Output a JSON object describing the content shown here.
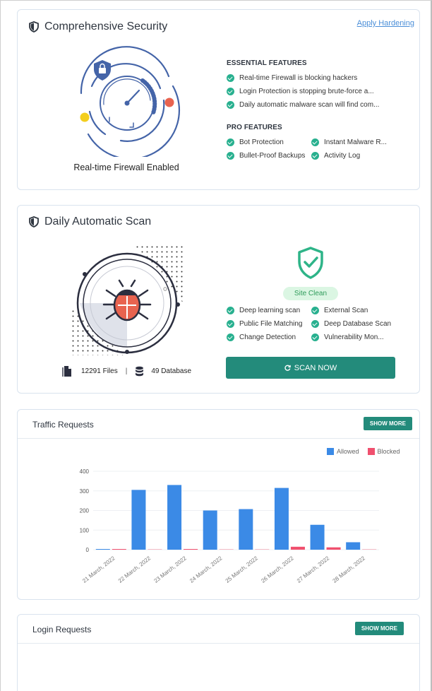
{
  "security": {
    "title": "Comprehensive Security",
    "apply_link": "Apply Hardening",
    "caption": "Real-time Firewall Enabled",
    "essential_heading": "ESSENTIAL FEATURES",
    "essential": [
      "Real-time Firewall is blocking hackers",
      "Login Protection is stopping brute-force a...",
      "Daily automatic malware scan will find com..."
    ],
    "pro_heading": "PRO FEATURES",
    "pro": [
      "Bot Protection",
      "Instant Malware R...",
      "Bullet-Proof Backups",
      "Activity Log"
    ]
  },
  "scan": {
    "title": "Daily Automatic Scan",
    "status": "Site Clean",
    "features": [
      "Deep learning scan",
      "External Scan",
      "Public File Matching",
      "Deep Database Scan",
      "Change Detection",
      "Vulnerability Mon..."
    ],
    "files": "12291 Files",
    "separator": "|",
    "database": "49 Database",
    "button": "SCAN NOW"
  },
  "traffic": {
    "title": "Traffic Requests",
    "show_more": "SHOW MORE"
  },
  "login": {
    "title": "Login Requests",
    "show_more": "SHOW MORE"
  },
  "colors": {
    "accent": "#238b7b",
    "check": "#28b08f",
    "allowed": "#3b8ae6",
    "blocked": "#f0506e",
    "icon_blue": "#4464a8",
    "icon_red": "#e8634f",
    "icon_yellow": "#f3ce1e"
  },
  "chart_data": {
    "type": "bar",
    "categories": [
      "21 March, 2022",
      "22 March, 2022",
      "23 March, 2022",
      "24 March, 2022",
      "25 March, 2022",
      "26 March, 2022",
      "27 March, 2022",
      "28 March, 2022"
    ],
    "series": [
      {
        "name": "Allowed",
        "values": [
          2,
          305,
          330,
          200,
          207,
          315,
          127,
          38
        ]
      },
      {
        "name": "Blocked",
        "values": [
          1,
          0,
          1,
          0,
          0,
          15,
          12,
          0
        ]
      }
    ],
    "ylim": [
      0,
      400
    ],
    "yticks": [
      0,
      100,
      200,
      300,
      400
    ],
    "grid": true,
    "legend": "top-right",
    "xlabel": "",
    "ylabel": ""
  }
}
